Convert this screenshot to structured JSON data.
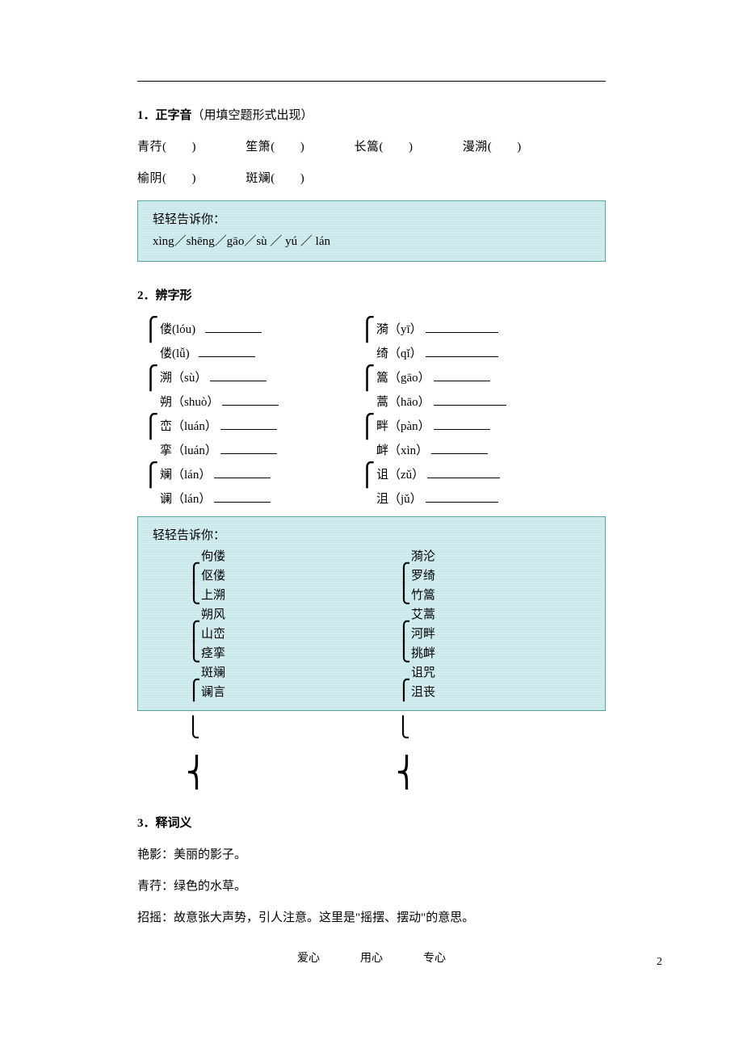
{
  "section1": {
    "number": "1．",
    "title": "正字音",
    "hint": "（用填空题形式出现）",
    "items": [
      "青荇(　　)",
      "笙箫(　　)",
      "长篙(　　)",
      "漫溯(　　)",
      "榆阴(　　)",
      "斑斓(　　)"
    ]
  },
  "hintLabel": "轻轻告诉你：",
  "section1Answer": "xìng／shēng／gāo／sù ／ yú ／ lán",
  "section2": {
    "number": "2．",
    "title": "辨字形",
    "pairs": [
      {
        "left": [
          "偻(lóu)",
          "偻(lǚ)"
        ],
        "right": [
          "漪（yī）",
          "绮（qǐ）"
        ]
      },
      {
        "left": [
          "溯（sù）",
          "朔（shuò）"
        ],
        "right": [
          "篙（gāo）",
          "蒿（hāo）"
        ]
      },
      {
        "left": [
          "峦（luán）",
          "挛（luán）"
        ],
        "right": [
          "畔（pàn）",
          "衅（xìn）"
        ]
      },
      {
        "left": [
          "斓（lán）",
          "谰（lán）"
        ],
        "right": [
          "诅（zǔ）",
          "沮（jǔ）"
        ]
      }
    ]
  },
  "section2Answer": {
    "left": [
      "佝偻",
      "伛偻",
      "上溯",
      "朔风",
      "山峦",
      "痉挛",
      "斑斓",
      "谰言"
    ],
    "right": [
      "漪沦",
      "罗绮",
      "竹篙",
      "艾蒿",
      "河畔",
      "挑衅",
      "诅咒",
      "沮丧"
    ]
  },
  "section3": {
    "number": "3．",
    "title": "释词义",
    "defs": [
      {
        "term": "艳影：",
        "def": "美丽的影子。"
      },
      {
        "term": "青荇：",
        "def": "绿色的水草。"
      },
      {
        "term": "招摇：",
        "def": "故意张大声势，引人注意。这里是\"摇摆、摆动\"的意思。"
      }
    ]
  },
  "footer": {
    "left": "爱心",
    "mid": "用心",
    "right": "专心",
    "page": "2"
  }
}
